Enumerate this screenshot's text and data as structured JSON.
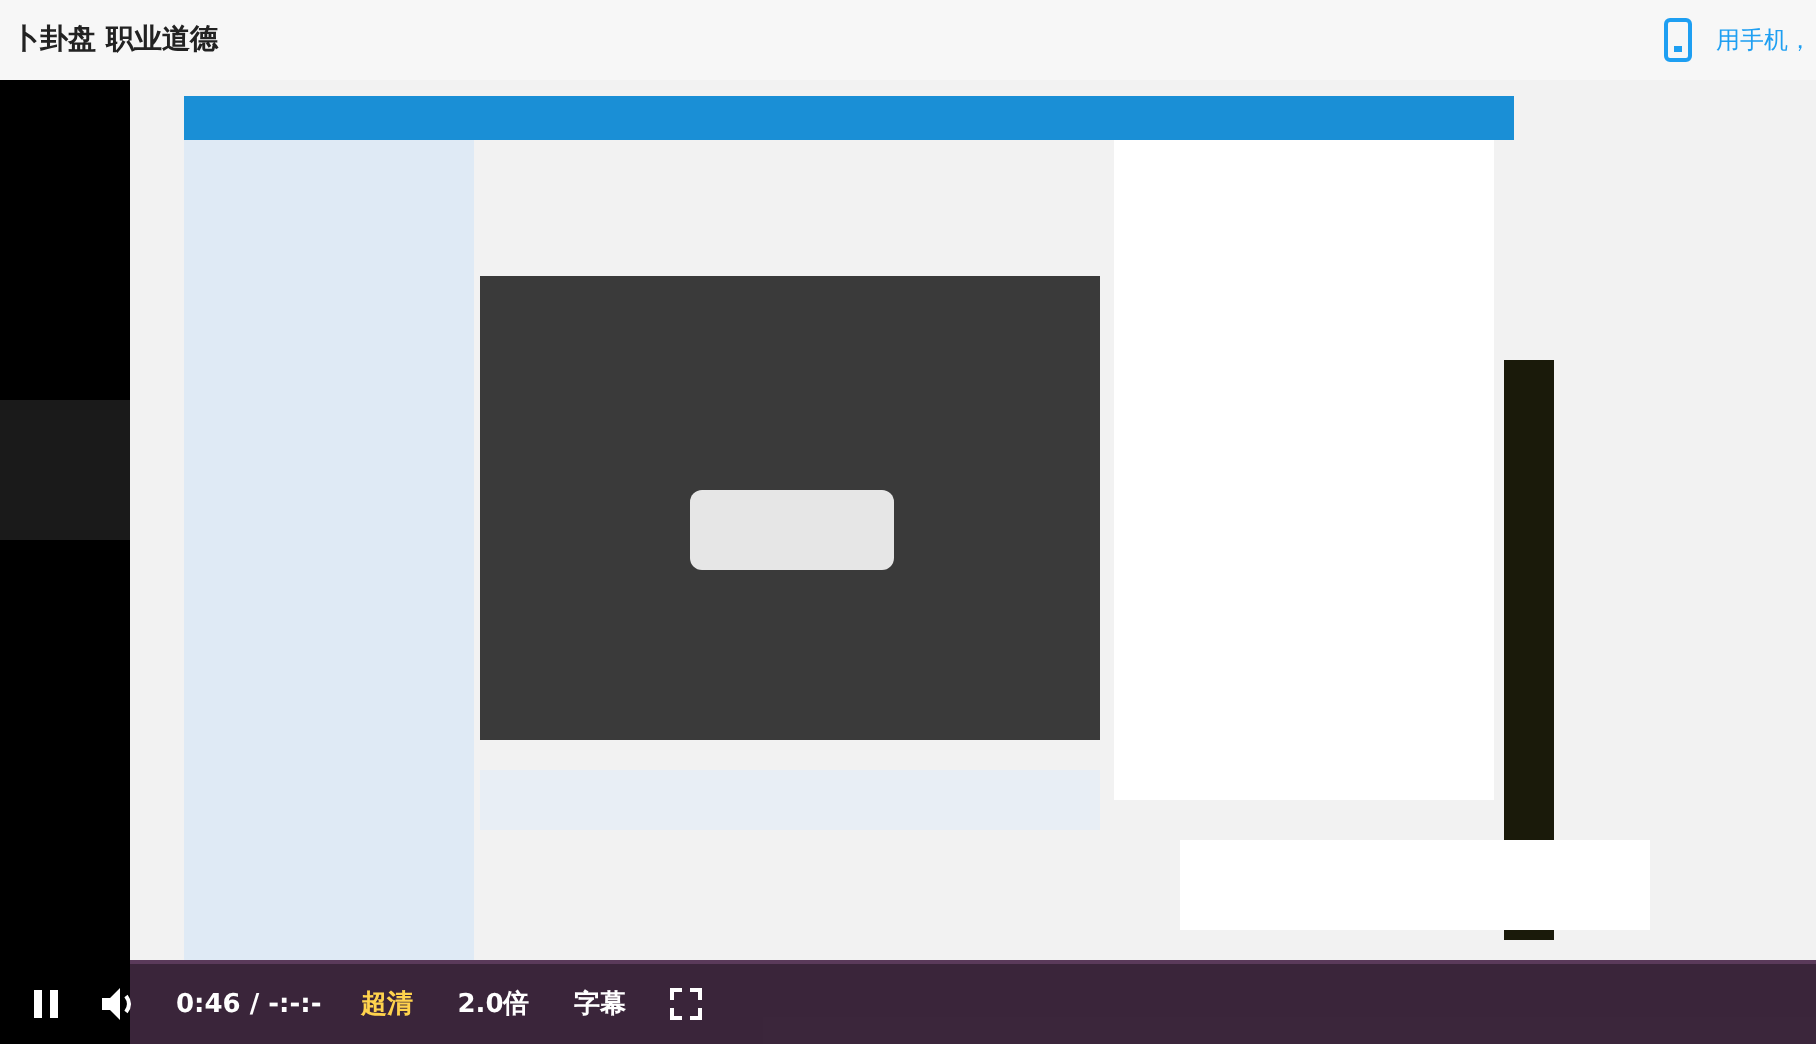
{
  "header": {
    "title": "卜卦盘 职业道德",
    "mobile_link": "用手机，"
  },
  "video": {
    "playing": true,
    "time": "0:46 / -:-:-",
    "quality": "超清",
    "speed": "2.0倍",
    "subtitles": "字幕"
  }
}
